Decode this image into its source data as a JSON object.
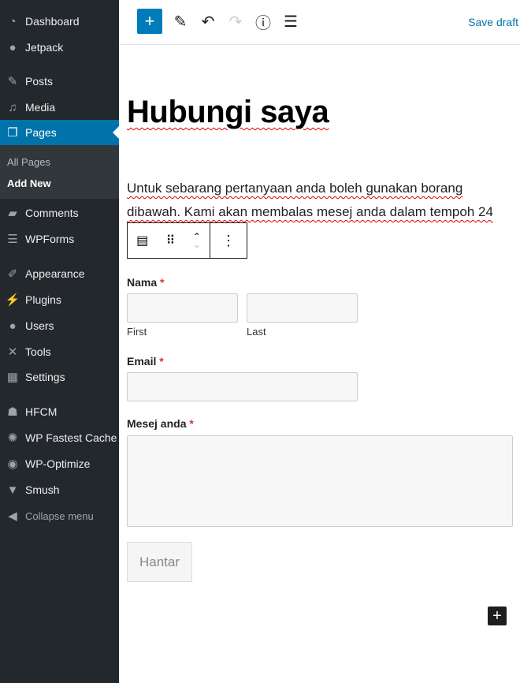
{
  "sidebar": {
    "items": [
      {
        "label": "Dashboard",
        "icon": "dashboard-icon",
        "glyph": "◔"
      },
      {
        "label": "Jetpack",
        "icon": "jetpack-icon",
        "glyph": "●"
      },
      {
        "label": "Posts",
        "icon": "pin-icon",
        "glyph": "✎"
      },
      {
        "label": "Media",
        "icon": "media-icon",
        "glyph": "♫"
      },
      {
        "label": "Pages",
        "icon": "pages-icon",
        "glyph": "❐"
      },
      {
        "label": "Comments",
        "icon": "comment-icon",
        "glyph": "▰"
      },
      {
        "label": "WPForms",
        "icon": "wpforms-icon",
        "glyph": "☰"
      },
      {
        "label": "Appearance",
        "icon": "brush-icon",
        "glyph": "✐"
      },
      {
        "label": "Plugins",
        "icon": "plugin-icon",
        "glyph": "⚡"
      },
      {
        "label": "Users",
        "icon": "user-icon",
        "glyph": "●"
      },
      {
        "label": "Tools",
        "icon": "wrench-icon",
        "glyph": "✕"
      },
      {
        "label": "Settings",
        "icon": "settings-icon",
        "glyph": "▦"
      },
      {
        "label": "HFCM",
        "icon": "hfcm-icon",
        "glyph": "☗"
      },
      {
        "label": "WP Fastest Cache",
        "icon": "cheetah-icon",
        "glyph": "✺"
      },
      {
        "label": "WP-Optimize",
        "icon": "optimize-icon",
        "glyph": "◉"
      },
      {
        "label": "Smush",
        "icon": "smush-icon",
        "glyph": "▼"
      },
      {
        "label": "Collapse menu",
        "icon": "collapse-icon",
        "glyph": "◀"
      }
    ],
    "submenu": [
      "All Pages",
      "Add New"
    ],
    "active": "Pages"
  },
  "toolbar": {
    "save_label": "Save draft"
  },
  "editor": {
    "title": "Hubungi saya",
    "paragraph": "Untuk sebarang pertanyaan anda boleh gunakan borang dibawah. Kami akan membalas mesej anda dalam tempoh 24",
    "form": {
      "name_label": "Nama",
      "first": "First",
      "last": "Last",
      "email_label": "Email",
      "message_label": "Mesej anda",
      "required": "*",
      "submit": "Hantar"
    }
  },
  "colors": {
    "sidebar": "#23282d",
    "accent": "#0073aa"
  }
}
